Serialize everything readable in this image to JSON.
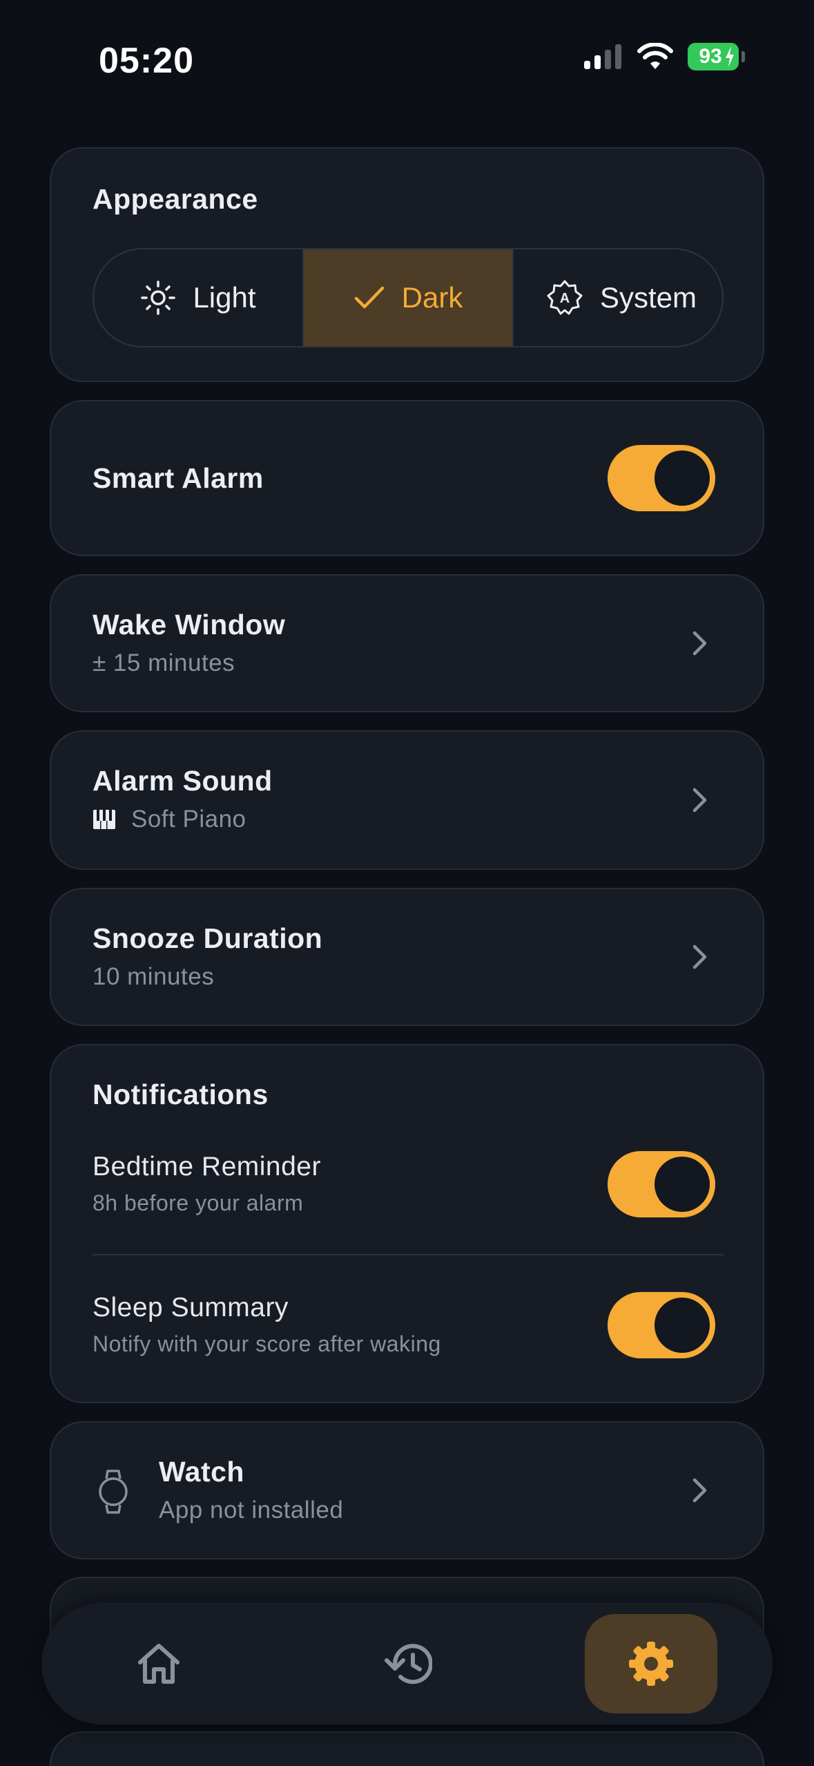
{
  "status_bar": {
    "time": "05:20",
    "battery": "93"
  },
  "appearance": {
    "title": "Appearance",
    "options": [
      {
        "label": "Light",
        "icon": "sun-icon"
      },
      {
        "label": "Dark",
        "icon": "check-icon",
        "selected": true
      },
      {
        "label": "System",
        "icon": "auto-icon"
      }
    ]
  },
  "smart_alarm": {
    "title": "Smart Alarm",
    "enabled": true
  },
  "wake_window": {
    "title": "Wake Window",
    "value": "± 15 minutes"
  },
  "alarm_sound": {
    "title": "Alarm Sound",
    "value": "Soft Piano",
    "icon": "piano-icon"
  },
  "snooze": {
    "title": "Snooze Duration",
    "value": "10 minutes"
  },
  "notifications": {
    "title": "Notifications",
    "items": [
      {
        "title": "Bedtime Reminder",
        "subtitle": "8h before your alarm",
        "enabled": true
      },
      {
        "title": "Sleep Summary",
        "subtitle": "Notify with your score after waking",
        "enabled": true
      }
    ]
  },
  "watch": {
    "title": "Watch",
    "subtitle": "App not installed",
    "icon": "watch-icon"
  },
  "nav": {
    "items": [
      "home-icon",
      "history-icon",
      "settings-icon"
    ],
    "active": "settings-icon"
  },
  "colors": {
    "accent": "#f5ab35",
    "card": "#171c24",
    "background": "#0c1016",
    "active_segment": "#4d3c26"
  }
}
